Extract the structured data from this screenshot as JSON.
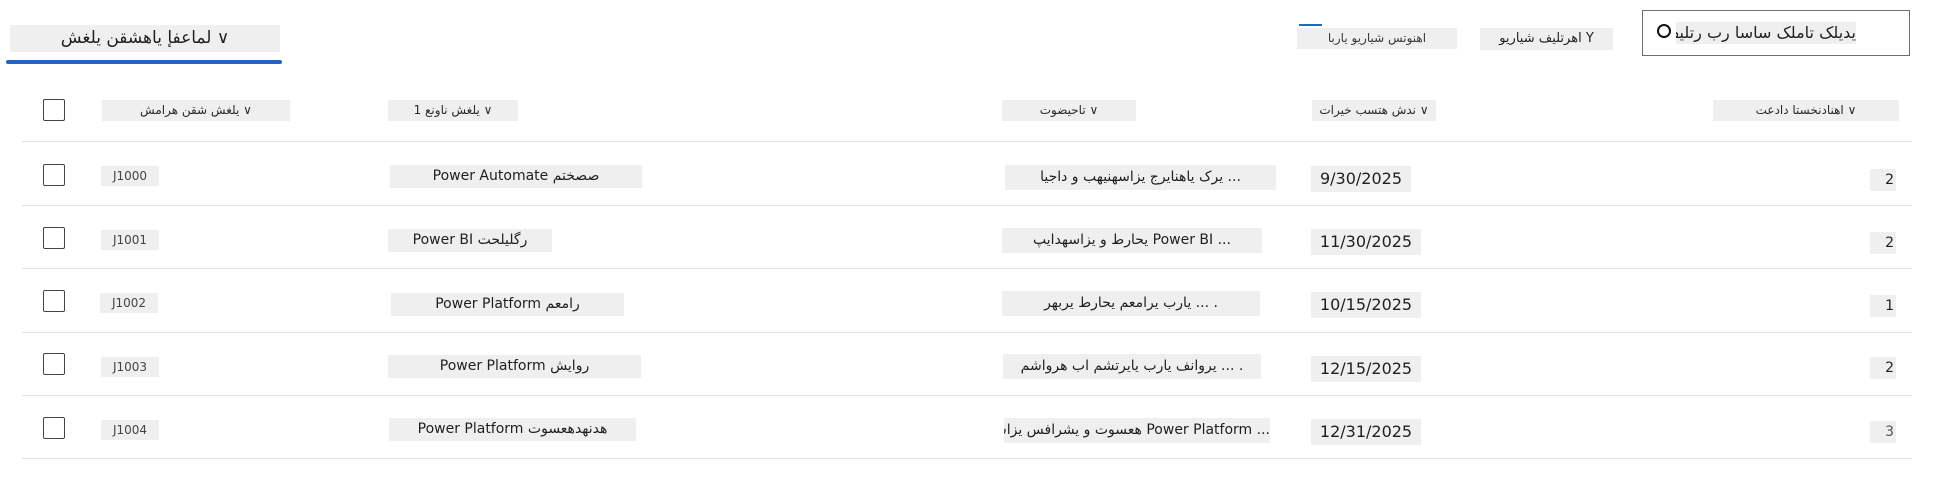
{
  "toolbar": {
    "active_tab": "لماعفإ یاهشقن یلغش ∨",
    "search_placeholder": "یدیلک تاملک ساسا رب رتلیف O",
    "filter_label": "اهرتلیف شیاریو Y",
    "show_label": "اهنوتس شیاریو یاربا"
  },
  "table": {
    "headers": {
      "type": "یلغش شقن هرامش ∨",
      "title": "یلغش ناونع 1 ∨",
      "description": "تاحیضوت ∨",
      "date": "ندش هتسب خیرات ∨",
      "priority": "اهنادنخستا دادعت ∨"
    },
    "rows": [
      {
        "id": "J1000",
        "title": "Power Automate صصختم",
        "description": "... یرک یاهنایرج یزاسهنیهب و داجیا",
        "date": "9/30/2025",
        "priority": "2"
      },
      {
        "id": "J1001",
        "title": "Power BI رگلیلحت",
        "description": "... Power BI یحارط و یزاسهدایپ",
        "date": "11/30/2025",
        "priority": "2"
      },
      {
        "id": "J1002",
        "title": "Power Platform رامعم",
        "description": ". ... یارب یرامعم یحارط یربهر",
        "date": "10/15/2025",
        "priority": "1"
      },
      {
        "id": "J1003",
        "title": "Power Platform روایش",
        "description": ". ... یروانف یارب یایرتشم اب هرواشم",
        "date": "12/15/2025",
        "priority": "2"
      },
      {
        "id": "J1004",
        "title": "Power Platform هدنهدهعسوت",
        "description": "... Power Platform هعسوت و یشرافس یزاس",
        "date": "12/31/2025",
        "priority": "3"
      }
    ]
  },
  "colors": {
    "accent": "#2266c3",
    "cell_background": "#efefef",
    "divider": "#e3e3e3"
  }
}
